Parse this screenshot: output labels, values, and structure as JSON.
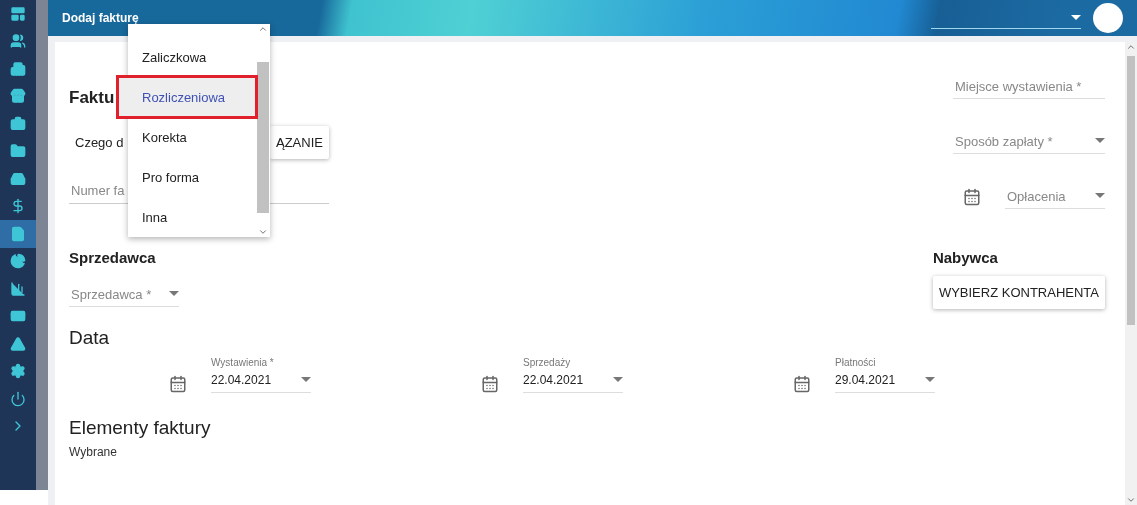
{
  "sidebar": {
    "items": [
      {
        "selected": false
      },
      {
        "selected": false
      },
      {
        "selected": false
      },
      {
        "selected": false
      },
      {
        "selected": false
      },
      {
        "selected": false
      },
      {
        "selected": false
      },
      {
        "selected": false
      },
      {
        "selected": true
      },
      {
        "selected": false
      },
      {
        "selected": false
      },
      {
        "selected": false
      },
      {
        "selected": false
      },
      {
        "selected": false
      },
      {
        "selected": false
      },
      {
        "selected": false
      }
    ]
  },
  "header": {
    "title": "Dodaj fakturę"
  },
  "form": {
    "title": "Faktu",
    "question": "Czego d",
    "question_button": "ĄZANIE",
    "invoice_number": {
      "placeholder": "Numer fa"
    },
    "place": {
      "placeholder": "Miejsce wystawienia *"
    },
    "payment_method": {
      "placeholder": "Sposób zapłaty *"
    },
    "paid_date": {
      "placeholder": "Opłacenia"
    },
    "seller": {
      "heading": "Sprzedawca",
      "select": {
        "placeholder": "Sprzedawca *"
      }
    },
    "buyer": {
      "heading": "Nabywca",
      "button": "WYBIERZ KONTRAHENTA"
    },
    "dates": {
      "heading": "Data",
      "fields": [
        {
          "label": "Wystawienia *",
          "value": "22.04.2021"
        },
        {
          "label": "Sprzedaży",
          "value": "22.04.2021"
        },
        {
          "label": "Płatności",
          "value": "29.04.2021"
        }
      ]
    },
    "items": {
      "heading": "Elementy faktury",
      "subheading": "Wybrane"
    }
  },
  "menu": {
    "items": [
      {
        "label": "Zaliczkowa",
        "selected": false,
        "annotated": false
      },
      {
        "label": "Rozliczeniowa",
        "selected": true,
        "annotated": true
      },
      {
        "label": "Korekta",
        "selected": false,
        "annotated": false
      },
      {
        "label": "Pro forma",
        "selected": false,
        "annotated": false
      },
      {
        "label": "Inna",
        "selected": false,
        "annotated": false
      }
    ]
  }
}
